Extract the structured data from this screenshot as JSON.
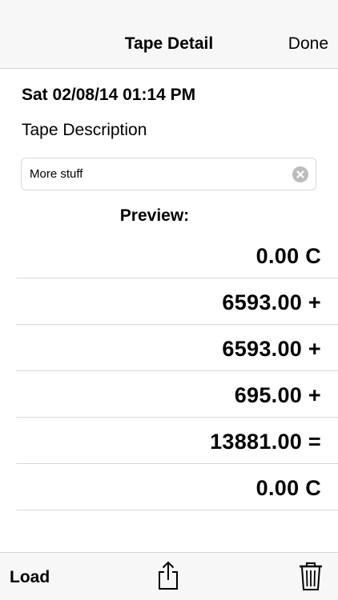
{
  "navbar": {
    "title": "Tape Detail",
    "done_label": "Done"
  },
  "tape": {
    "timestamp": "Sat 02/08/14 01:14 PM",
    "description_label": "Tape Description",
    "description_value": "More stuff",
    "preview_label": "Preview:",
    "entries": [
      "0.00 C",
      "6593.00 +",
      "6593.00 +",
      "695.00 +",
      "13881.00 =",
      "0.00 C"
    ]
  },
  "toolbar": {
    "load_label": "Load",
    "share_icon": "share-icon",
    "trash_icon": "trash-icon"
  }
}
